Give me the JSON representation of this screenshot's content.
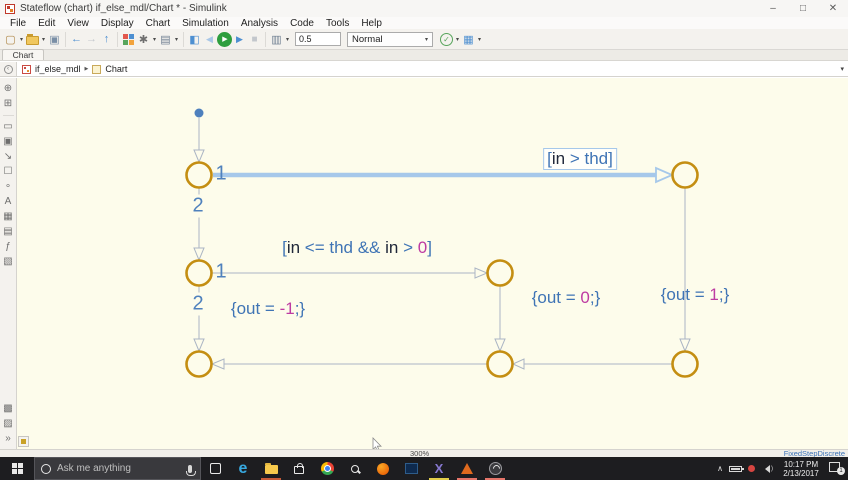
{
  "window": {
    "title": "Stateflow (chart) if_else_mdl/Chart * - Simulink",
    "controls": {
      "minimize": "–",
      "maximize": "□",
      "close": "✕"
    }
  },
  "menu": {
    "items": [
      "File",
      "Edit",
      "View",
      "Display",
      "Chart",
      "Simulation",
      "Analysis",
      "Code",
      "Tools",
      "Help"
    ]
  },
  "toolbar": {
    "stop_time": "0.5",
    "sim_mode": "Normal",
    "glyphs": {
      "new": "▢",
      "save": "▣",
      "back": "←",
      "forward": "→",
      "up": "↑",
      "gear": "✱",
      "model_explorer": "▤",
      "connector": "◧",
      "step_back": "◀",
      "play": "▶",
      "step_forward": "▶",
      "stop": "■",
      "scope": "▥",
      "check": "✓",
      "build": "▦",
      "caret": "▾"
    }
  },
  "tab": {
    "label": "Chart"
  },
  "breadcrumb": {
    "model": "if_else_mdl",
    "chart": "Chart",
    "separator": "▶",
    "back_glyph": "‹",
    "caret": "▾"
  },
  "palette": {
    "icons": [
      {
        "name": "zoom",
        "glyph": "⊕"
      },
      {
        "name": "fit-to-view",
        "glyph": "⊞"
      },
      {
        "name": "state",
        "glyph": "▭"
      },
      {
        "name": "subchart",
        "glyph": "▣"
      },
      {
        "name": "default-transition",
        "glyph": "↘"
      },
      {
        "name": "box",
        "glyph": "☐"
      },
      {
        "name": "connective-junction",
        "glyph": "∘"
      },
      {
        "name": "annotation",
        "glyph": "A"
      },
      {
        "name": "image",
        "glyph": "▦"
      },
      {
        "name": "truth-table",
        "glyph": "▤"
      },
      {
        "name": "matlab-function",
        "glyph": "ƒ"
      },
      {
        "name": "simulink-function",
        "glyph": "▧"
      }
    ],
    "bottom_icons": [
      {
        "name": "explorer-bar",
        "glyph": "▩"
      },
      {
        "name": "symbols",
        "glyph": "▨"
      },
      {
        "name": "expand",
        "glyph": "»"
      }
    ]
  },
  "diagram": {
    "port_labels": [
      "1",
      "2",
      "1",
      "2"
    ],
    "labels": [
      {
        "id": "condition-in-gt-thd",
        "parts": [
          {
            "t": "[",
            "c": "base"
          },
          {
            "t": "in",
            "c": "ident"
          },
          {
            "t": " > thd]",
            "c": "base"
          }
        ]
      },
      {
        "id": "condition-in-le-thd-and-gt-0",
        "parts": [
          {
            "t": "[",
            "c": "base"
          },
          {
            "t": "in",
            "c": "ident"
          },
          {
            "t": " <= thd && ",
            "c": "base"
          },
          {
            "t": "in",
            "c": "ident"
          },
          {
            "t": " > ",
            "c": "base"
          },
          {
            "t": "0",
            "c": "number"
          },
          {
            "t": "]",
            "c": "base"
          }
        ]
      },
      {
        "id": "action-out-neg1",
        "parts": [
          {
            "t": "{out = ",
            "c": "base"
          },
          {
            "t": "-1",
            "c": "number"
          },
          {
            "t": ";}",
            "c": "base"
          }
        ]
      },
      {
        "id": "action-out-0",
        "parts": [
          {
            "t": "{out = ",
            "c": "base"
          },
          {
            "t": "0",
            "c": "number"
          },
          {
            "t": ";}",
            "c": "base"
          }
        ]
      },
      {
        "id": "action-out-1",
        "parts": [
          {
            "t": "{out = ",
            "c": "base"
          },
          {
            "t": "1",
            "c": "number"
          },
          {
            "t": ";}",
            "c": "base"
          }
        ]
      }
    ]
  },
  "statusbar": {
    "zoom": "300%",
    "solver": "FixedStepDiscrete"
  },
  "taskbar": {
    "search_placeholder": "Ask me anything",
    "time": "10:17 PM",
    "date": "2/13/2017",
    "notification_count": "1",
    "edge_glyph": "e",
    "vmx_glyph": "X",
    "tray_chevron": "∧",
    "speaker_wave": ")"
  },
  "colors": {
    "canvas": "#FDFCEB",
    "junction": "#C48E12",
    "line": "#ABB5C4",
    "selected": "#A6C8EA",
    "start_dot": "#4E80BD",
    "port": "#4F81BD",
    "solver": "#3B73B9",
    "taskbar": "#1D1D20",
    "run_button": "#2E9E3E",
    "syntax": {
      "base": "#3F74B5",
      "ident": "#20283A",
      "number": "#BE3BA2"
    }
  }
}
